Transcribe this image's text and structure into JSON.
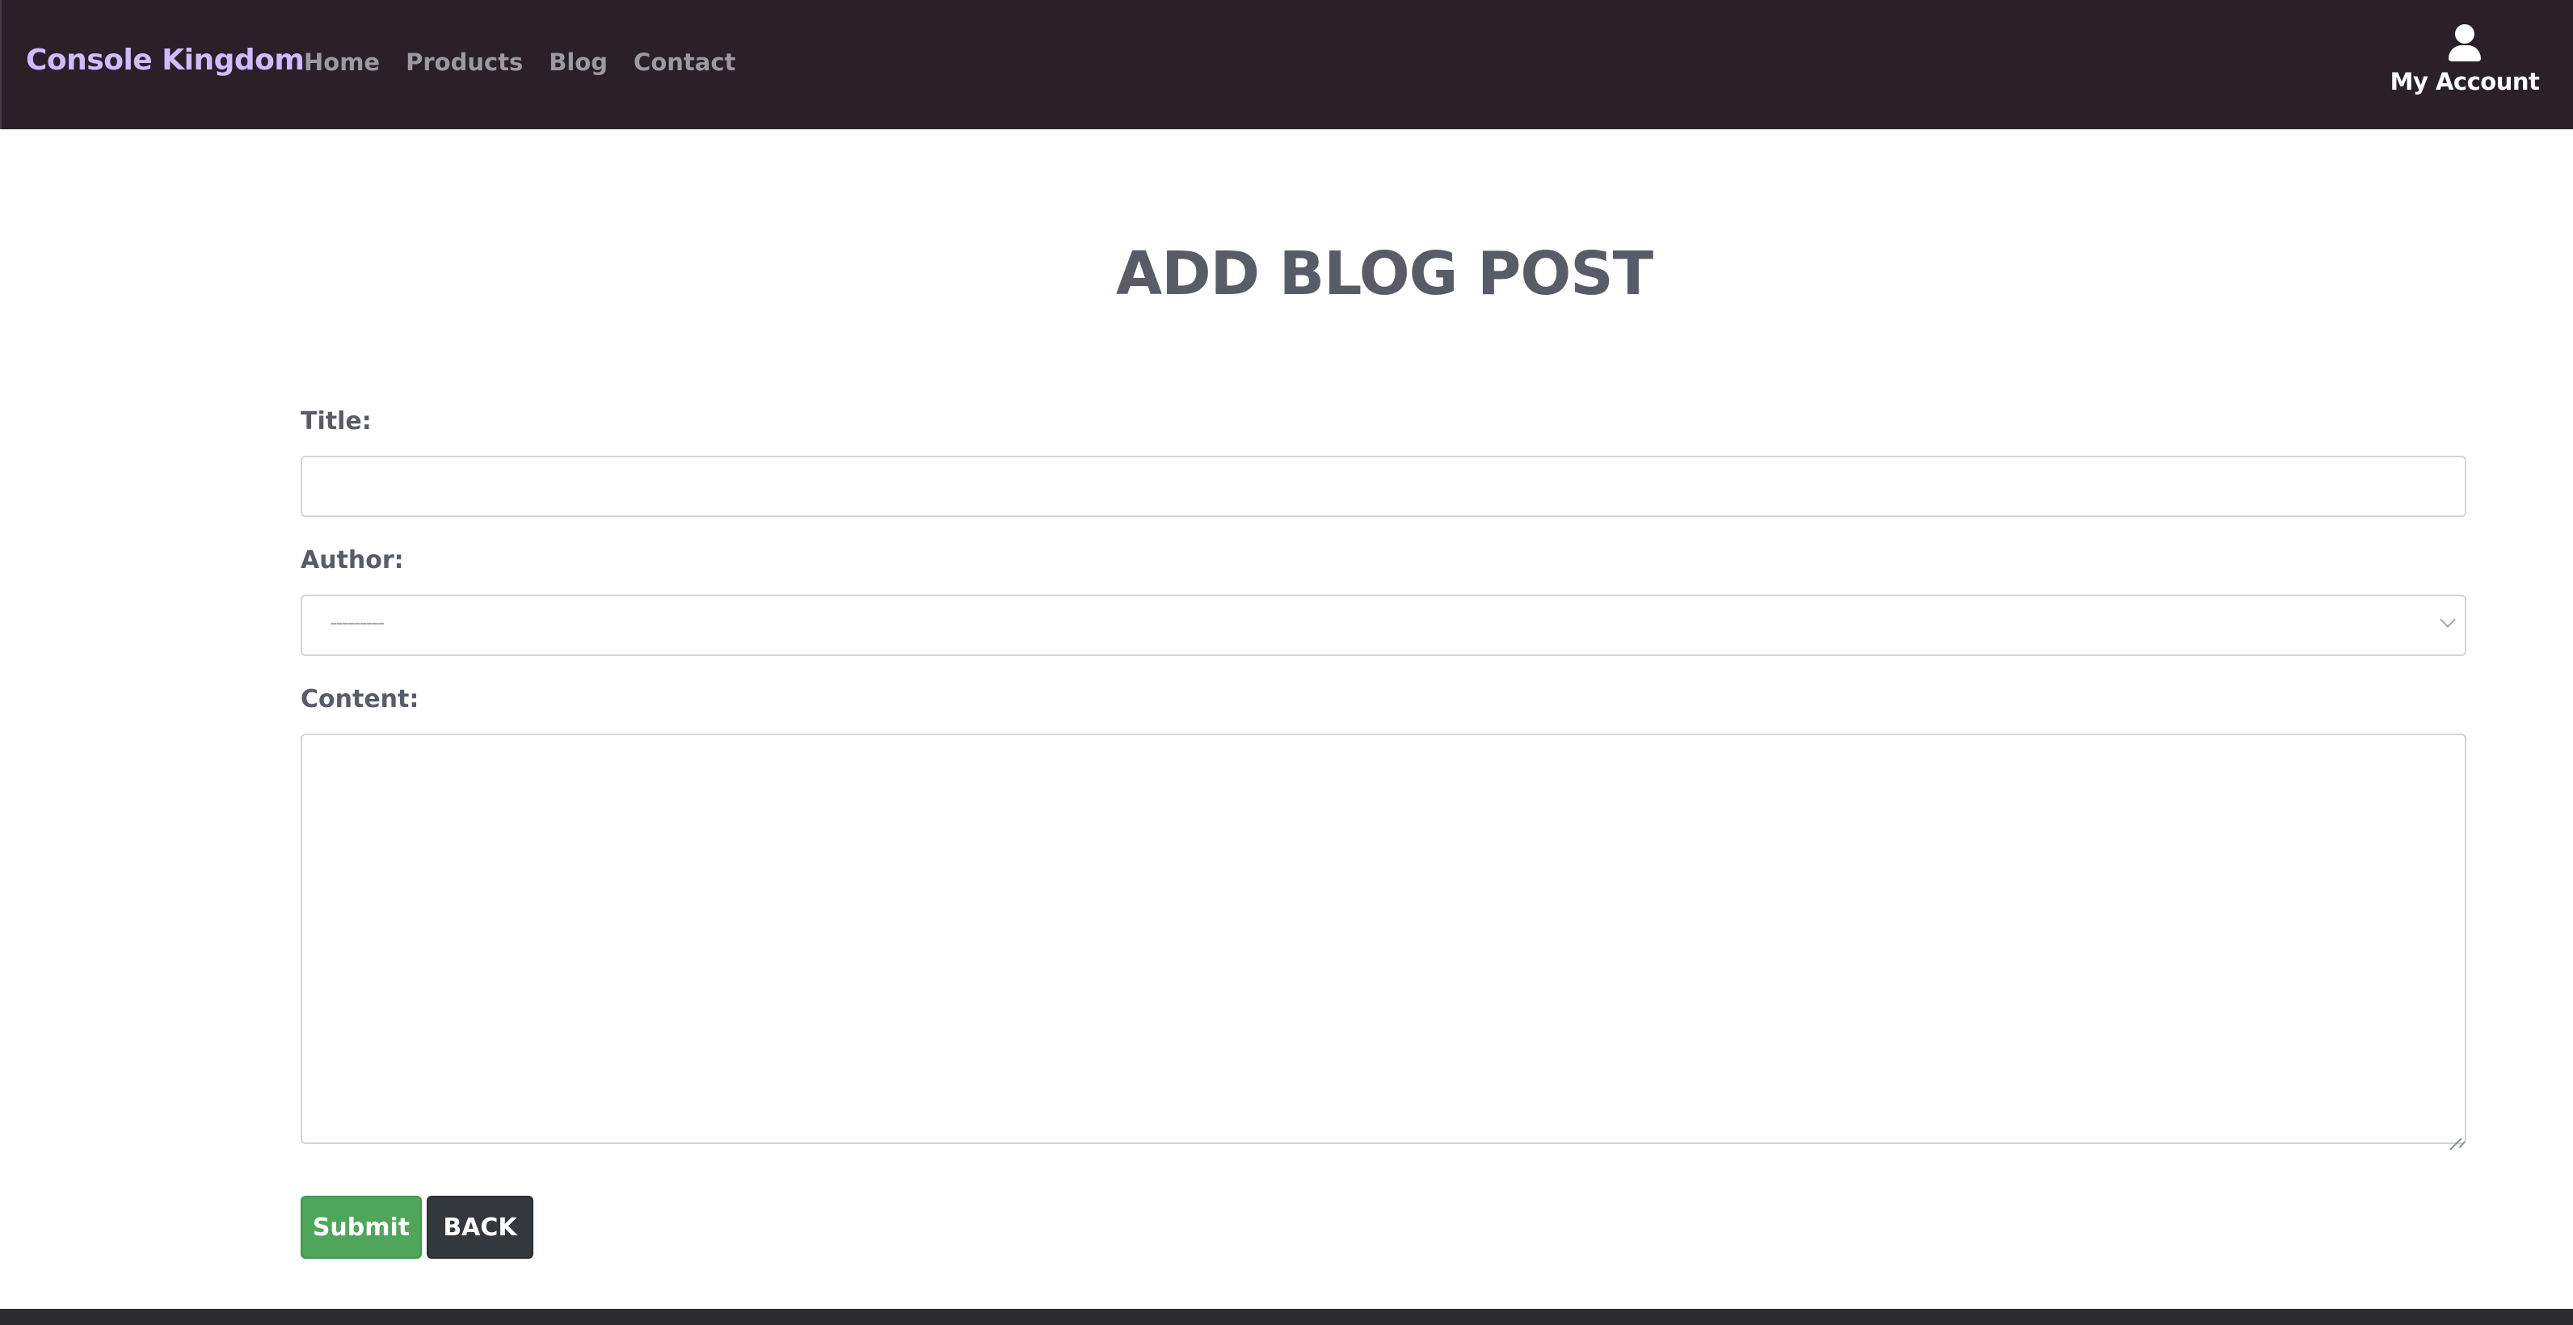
{
  "navbar": {
    "brand": "Console Kingdom",
    "links": [
      "Home",
      "Products",
      "Blog",
      "Contact"
    ],
    "account_label": "My Account",
    "account_icon": "user-icon"
  },
  "page": {
    "title": "ADD BLOG POST"
  },
  "form": {
    "title_label": "Title:",
    "title_value": "",
    "author_label": "Author:",
    "author_selected": "---------",
    "content_label": "Content:",
    "content_value": "",
    "submit_label": "Submit",
    "back_label": "BACK"
  },
  "colors": {
    "navbar_bg": "#2b1f28",
    "brand": "#cdbcff",
    "submit": "#4fa65a",
    "back": "#33383e",
    "heading": "#585c66"
  }
}
